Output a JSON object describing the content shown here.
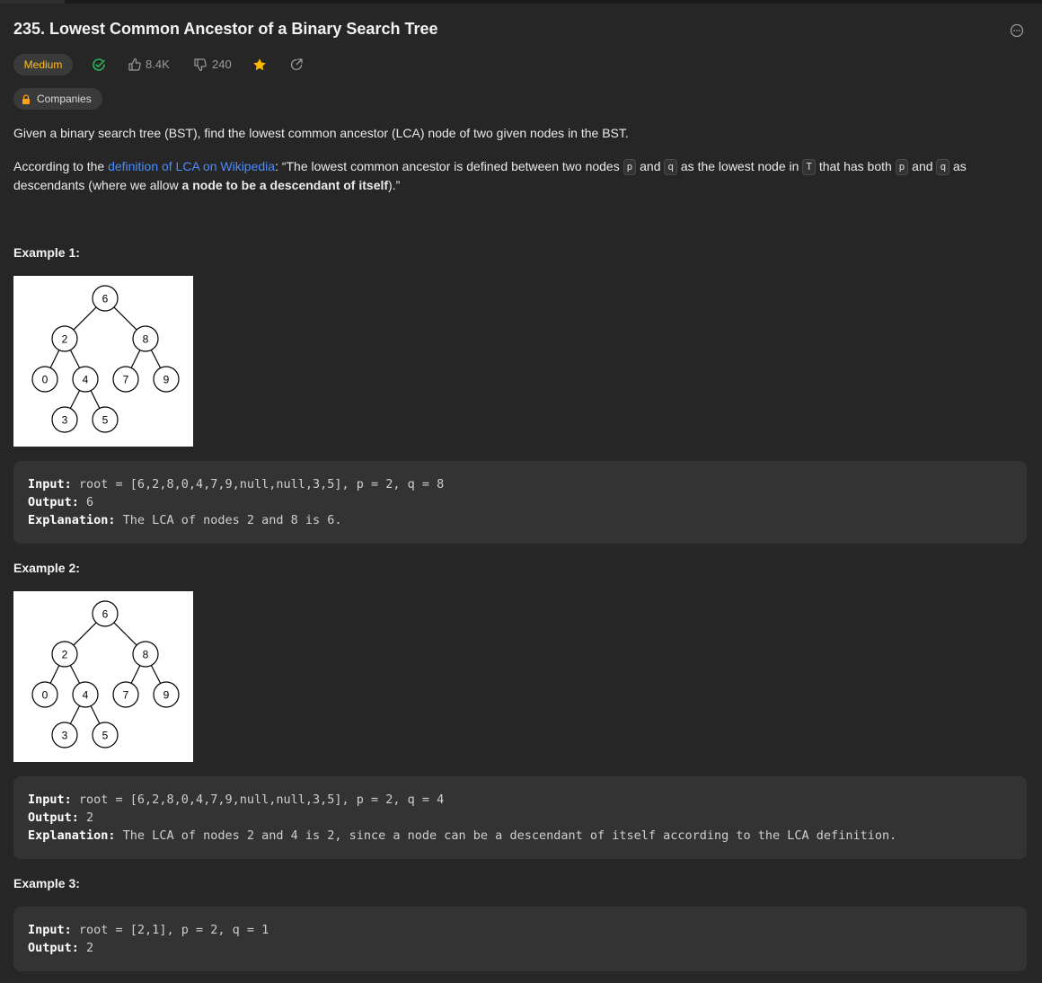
{
  "problem": {
    "title": "235. Lowest Common Ancestor of a Binary Search Tree",
    "difficulty": "Medium",
    "likes": "8.4K",
    "dislikes": "240",
    "companies_label": "Companies",
    "colors": {
      "difficulty": "#ffc01e",
      "solved_check": "#2cbb5d",
      "star": "#ffb800",
      "link": "#4a8cff"
    },
    "icons": [
      "more-options-icon",
      "solved-check-icon",
      "thumbs-up-icon",
      "thumbs-down-icon",
      "star-icon",
      "share-icon",
      "lock-icon"
    ]
  },
  "description": {
    "p1": "Given a binary search tree (BST), find the lowest common ancestor (LCA) node of two given nodes in the BST.",
    "p2_before_link": "According to the ",
    "p2_link": "definition of LCA on Wikipedia",
    "p2_after_link": ": “The lowest common ancestor is defined between two nodes ",
    "code_p": "p",
    "and": " and ",
    "code_q": "q",
    "p2_mid": " as the lowest node in ",
    "code_T": "T",
    "p2_mid2": " that has both ",
    "p2_end_start": " as descendants (where we allow ",
    "p2_bold": "a node to be a descendant of itself",
    "p2_end": ").”"
  },
  "tree": {
    "nodes": [
      "6",
      "2",
      "8",
      "0",
      "4",
      "7",
      "9",
      "3",
      "5"
    ]
  },
  "examples": [
    {
      "title": "Example 1:",
      "input_label": "Input:",
      "input": " root = [6,2,8,0,4,7,9,null,null,3,5], p = 2, q = 8",
      "output_label": "Output:",
      "output": " 6",
      "explanation_label": "Explanation:",
      "explanation": " The LCA of nodes 2 and 8 is 6."
    },
    {
      "title": "Example 2:",
      "input_label": "Input:",
      "input": " root = [6,2,8,0,4,7,9,null,null,3,5], p = 2, q = 4",
      "output_label": "Output:",
      "output": " 2",
      "explanation_label": "Explanation:",
      "explanation": " The LCA of nodes 2 and 4 is 2, since a node can be a descendant of itself according to the LCA definition."
    },
    {
      "title": "Example 3:",
      "input_label": "Input:",
      "input": " root = [2,1], p = 2, q = 1",
      "output_label": "Output:",
      "output": " 2"
    }
  ]
}
